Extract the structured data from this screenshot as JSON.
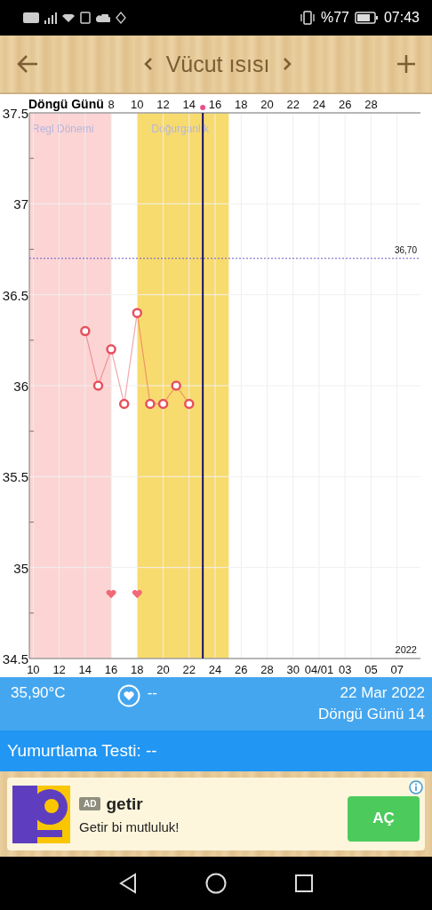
{
  "status_bar": {
    "battery_text": "%77",
    "time": "07:43"
  },
  "header": {
    "title": "Vücut ısısı"
  },
  "chart": {
    "top_axis": {
      "title": "Döngü Günü",
      "ticks": [
        "8",
        "10",
        "12",
        "14",
        "16",
        "18",
        "20",
        "22",
        "24",
        "26",
        "28"
      ]
    },
    "year_label": "2022",
    "bands": [
      {
        "label": "Regl Dönemi",
        "color": "#fcd4d4"
      },
      {
        "label": "Doğurganlık",
        "color": "#f8db6e"
      }
    ],
    "markers": [
      {
        "kind": "heart",
        "day": "16"
      },
      {
        "kind": "heart",
        "day": "18"
      }
    ],
    "chart_data": {
      "type": "line",
      "categories": [
        "10",
        null,
        "12",
        null,
        "14",
        null,
        "16",
        null,
        "18",
        null,
        "20",
        null,
        "22",
        null,
        "24",
        null,
        "26",
        null,
        "28",
        null,
        "30",
        null,
        "04/01",
        null,
        "03",
        null,
        "05",
        null,
        "07"
      ],
      "grid": true,
      "ref_lines": [
        {
          "axis": "y",
          "value": 36.7,
          "label": "36,70"
        }
      ],
      "series": [
        {
          "color": "#e5505c",
          "marker": "o",
          "values": [
            null,
            null,
            null,
            null,
            36.3,
            36.0,
            36.2,
            35.9,
            36.4,
            35.9,
            35.9,
            36.0,
            35.9,
            null,
            null,
            null,
            null,
            null,
            null,
            null,
            null,
            null,
            null,
            null,
            null,
            null,
            null,
            null,
            null
          ]
        }
      ],
      "ylim": [
        34.5,
        37.5
      ],
      "yticks": [
        37.5,
        37,
        36.5,
        36,
        35.5,
        35,
        34.5
      ]
    }
  },
  "info": {
    "temperature": "35,90°C",
    "intercourse": "--",
    "date": "22 Mar 2022",
    "cycle_day": "Döngü Günü 14"
  },
  "ovulation": {
    "label": "Yumurtlama Testi: --"
  },
  "ad": {
    "badge": "AD",
    "title": "getir",
    "text": "Getir bi mutluluk!",
    "button": "AÇ"
  }
}
